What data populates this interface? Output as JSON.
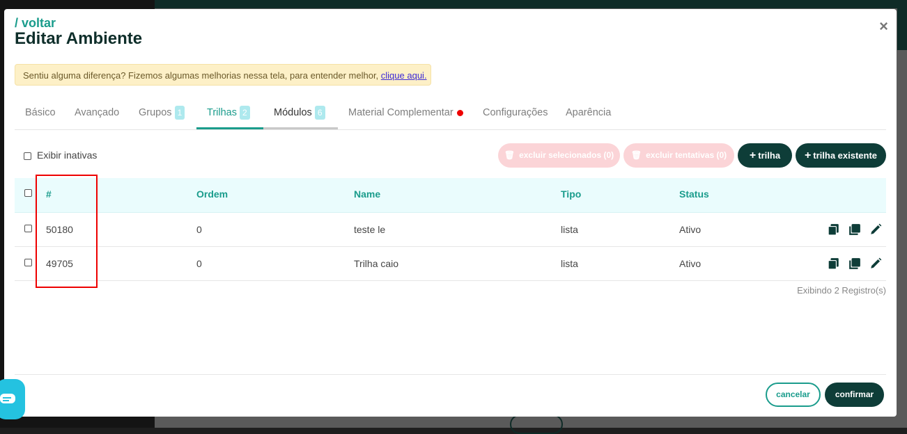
{
  "header": {
    "back_label": "/ voltar",
    "title": "Editar Ambiente",
    "close_label": "×"
  },
  "notice": {
    "text": "Sentiu alguma diferença? Fizemos algumas melhorias nessa tela, para entender melhor, ",
    "link": "clique aqui."
  },
  "tabs": [
    {
      "label": "Básico"
    },
    {
      "label": "Avançado"
    },
    {
      "label": "Grupos",
      "badge": "1"
    },
    {
      "label": "Trilhas",
      "badge": "2",
      "active": true
    },
    {
      "label": "Módulos",
      "badge": "6"
    },
    {
      "label": "Material Complementar"
    },
    {
      "label": "Configurações"
    },
    {
      "label": "Aparência"
    }
  ],
  "toolbar": {
    "show_inactive_label": "Exibir inativas",
    "delete_selected_label": "excluir selecionados (0)",
    "delete_attempts_label": "excluir tentativas (0)",
    "add_trail_label": "trilha",
    "add_existing_trail_label": "trilha existente"
  },
  "table": {
    "columns": [
      "#",
      "Ordem",
      "Name",
      "Tipo",
      "Status"
    ],
    "rows": [
      {
        "id": "50180",
        "ordem": "0",
        "name": "teste le",
        "tipo": "lista",
        "status": "Ativo"
      },
      {
        "id": "49705",
        "ordem": "0",
        "name": "Trilha caio",
        "tipo": "lista",
        "status": "Ativo"
      }
    ],
    "footer": "Exibindo 2 Registro(s)"
  },
  "footer": {
    "cancel_label": "cancelar",
    "confirm_label": "confirmar"
  },
  "colors": {
    "accent": "#1a9c8c",
    "dark": "#0e3d38",
    "highlight_box": "#ee0000"
  }
}
